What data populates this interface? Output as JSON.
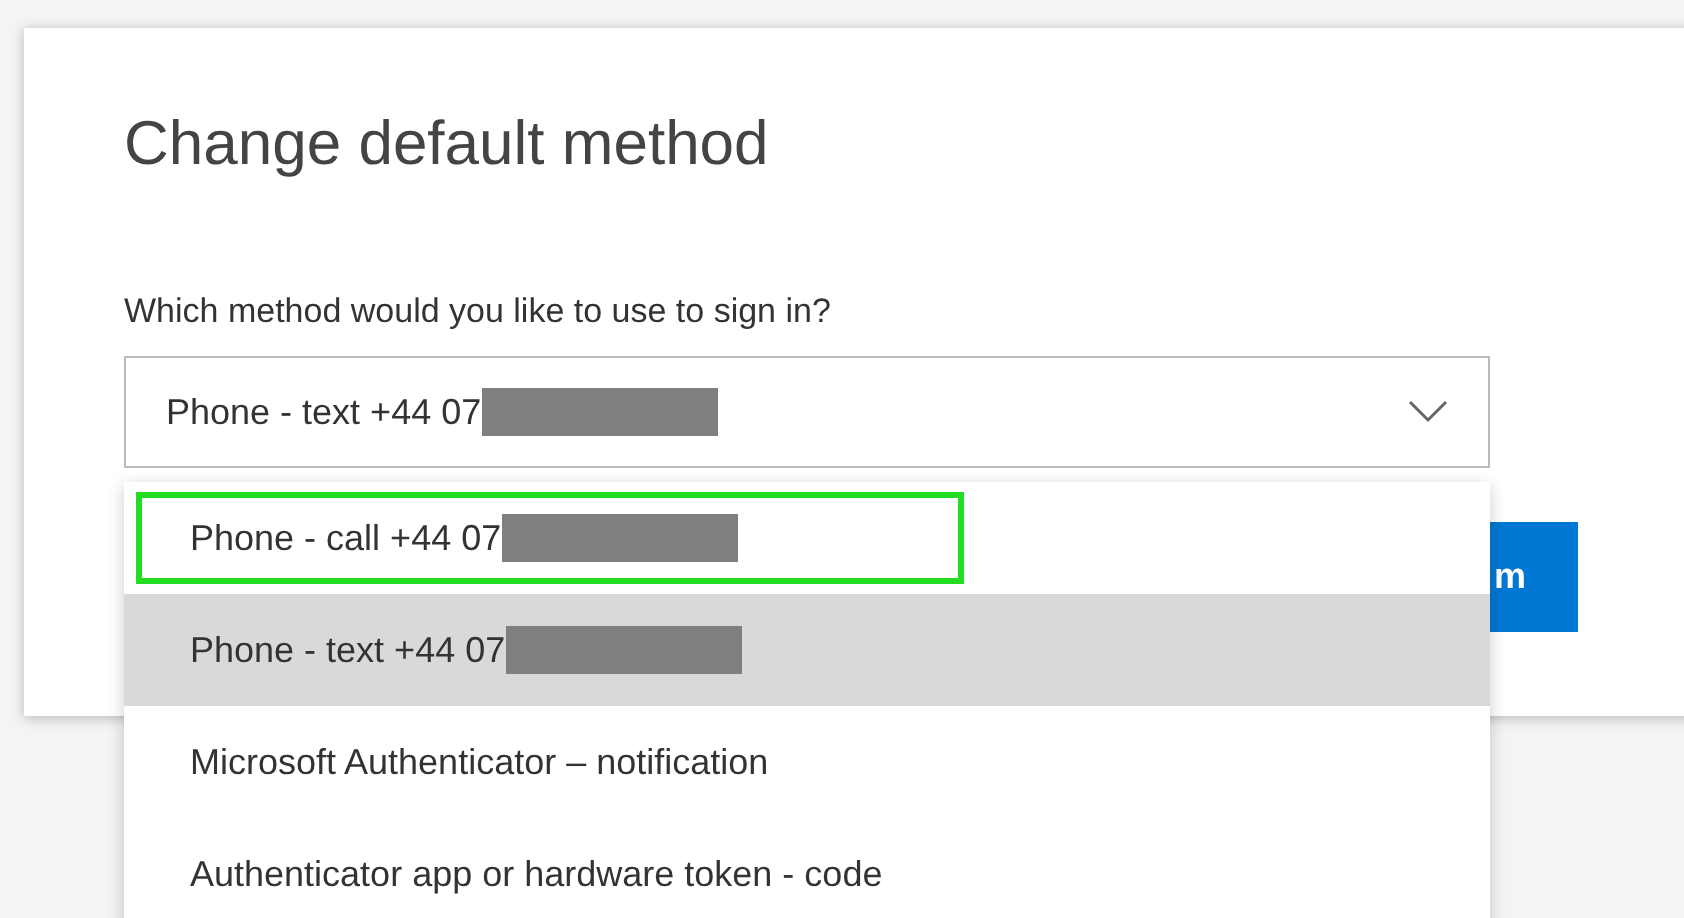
{
  "dialog": {
    "title": "Change default method",
    "prompt": "Which method would you like to use to sign in?",
    "select": {
      "value": "Phone - text +44 07",
      "value_redacted": true,
      "expanded": true
    },
    "button": {
      "label": "m"
    },
    "options": [
      {
        "label": "Phone - call +44 07",
        "redacted": true,
        "selected": false,
        "outlined": true
      },
      {
        "label": "Phone - text +44 07",
        "redacted": true,
        "selected": true,
        "outlined": false
      },
      {
        "label": "Microsoft Authenticator – notification",
        "redacted": false,
        "selected": false,
        "outlined": false
      },
      {
        "label": "Authenticator app or hardware token - code",
        "redacted": false,
        "selected": false,
        "outlined": false
      }
    ]
  }
}
